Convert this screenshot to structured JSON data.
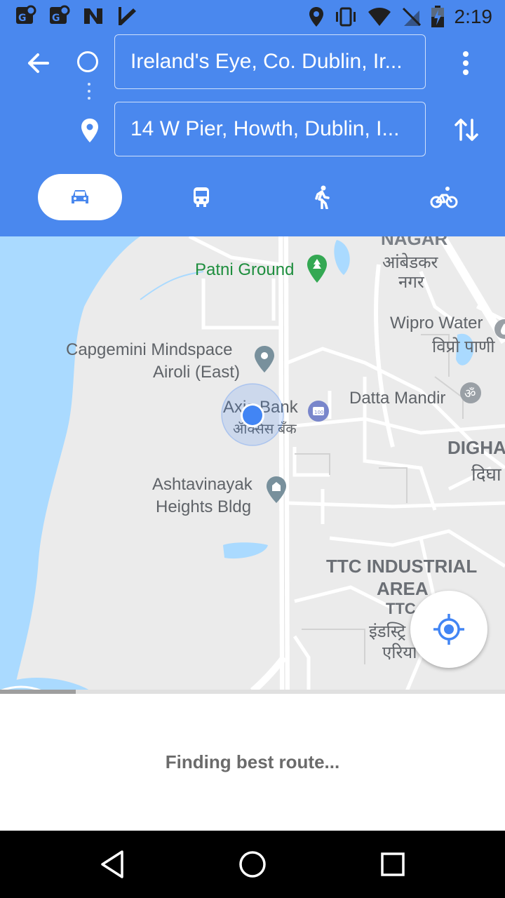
{
  "status_bar": {
    "time": "2:19",
    "left_icons": [
      "maps-notification-icon",
      "maps-notification-icon",
      "n-notification-icon",
      "check-notification-icon"
    ],
    "right_icons": [
      "location-icon",
      "vibrate-icon",
      "wifi-icon",
      "no-sim-icon",
      "battery-charging-icon"
    ]
  },
  "directions": {
    "origin": "Ireland's Eye, Co. Dublin, Ir...",
    "destination": "14 W Pier, Howth, Dublin, I...",
    "modes": [
      {
        "name": "driving",
        "selected": true
      },
      {
        "name": "transit",
        "selected": false
      },
      {
        "name": "walking",
        "selected": false
      },
      {
        "name": "cycling",
        "selected": false
      }
    ]
  },
  "map": {
    "labels": {
      "nagar_en": "NAGAR",
      "nagar_hi_1": "आंबेडकर",
      "nagar_hi_2": "नगर",
      "patni": "Patni Ground",
      "wipro_en": "Wipro Water",
      "wipro_hi": "विप्रो पाणी",
      "capgemini_1": "Capgemini Mindspace",
      "capgemini_2": "Airoli (East)",
      "axis_en": "Axis Bank",
      "axis_hi": "ॲक्सिस बँक",
      "datta": "Datta Mandir",
      "digha_en": "DIGHA",
      "digha_hi": "दिघा",
      "ashta_1": "Ashtavinayak",
      "ashta_2": "Heights Bldg",
      "ttc_1": "TTC INDUSTRIAL",
      "ttc_2": "AREA",
      "ttc_hi_1": "TTC",
      "ttc_hi_2": "इंडस्ट्रि",
      "ttc_hi_3": "एरिया"
    }
  },
  "bottom_sheet": {
    "status": "Finding best route...",
    "progress": 0.15
  },
  "colors": {
    "header": "#4a88ee",
    "water": "#aadaff",
    "accent": "#4285f4"
  }
}
